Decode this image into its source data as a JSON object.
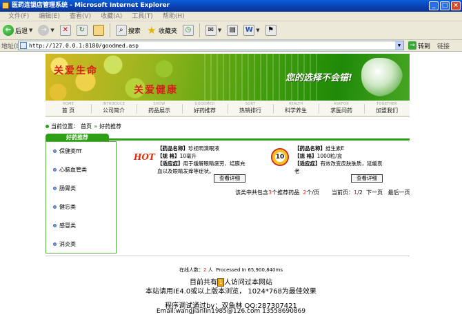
{
  "window": {
    "title": "医药连锁店管理系统 - Microsoft Internet Explorer",
    "controls": [
      "_",
      "□",
      "×"
    ]
  },
  "menu": [
    "文件(F)",
    "编辑(E)",
    "查看(V)",
    "收藏(A)",
    "工具(T)",
    "帮助(H)"
  ],
  "toolbar": {
    "back_label": "后退",
    "search_label": "搜索",
    "favorites_label": "收藏夹"
  },
  "address": {
    "label": "地址(D)",
    "url": "http://127.0.0.1:8180/goodmed.asp",
    "go_label": "转到",
    "links_label": "链接"
  },
  "banner": {
    "slogan_left_1": "关爱生命",
    "slogan_left_2": "关爱健康",
    "slogan_right": "您的选择不会错!"
  },
  "nav": [
    {
      "en": "HOME",
      "cn": "首 页"
    },
    {
      "en": "INTRODUCE",
      "cn": "公司简介"
    },
    {
      "en": "SHOW",
      "cn": "药品展示"
    },
    {
      "en": "GOODMED",
      "cn": "好药推荐"
    },
    {
      "en": "SORT",
      "cn": "热销排行"
    },
    {
      "en": "HEALTH",
      "cn": "科学养生"
    },
    {
      "en": "ASKFOR",
      "cn": "求医问药"
    },
    {
      "en": "TOGETHER",
      "cn": "加盟我们"
    }
  ],
  "breadcrumb": {
    "prefix": "当前位置：",
    "home": "首页",
    "arrow": "»",
    "current": "好药推荐"
  },
  "sidebar": {
    "tab_title": "好药推荐",
    "items": [
      "保健类fff",
      "心脑血管类",
      "肠胃类",
      "健忘类",
      "感冒类",
      "消炎类"
    ]
  },
  "products": [
    {
      "image_text": "HOT",
      "name_label": "【药品名称】",
      "name": "珍视明滴眼液",
      "spec_label": "【规  格】",
      "spec": "10毫升",
      "indication_label": "【适应症】",
      "indication": "用于缓解眼睛疲劳、结膜充血以及眼睛发痒等症状。",
      "detail_button": "查看详细"
    },
    {
      "image_text": "10",
      "name_label": "【药品名称】",
      "name": "维生素E",
      "spec_label": "【规  格】",
      "spec": "1000粒/盒",
      "indication_label": "【适应症】",
      "indication": "有效改变皮肤肤质，延缓衰老",
      "detail_button": "查看详细"
    }
  ],
  "pager": {
    "summary_pre": "该类中共包含",
    "total": "3",
    "summary_mid": "个推荐药品",
    "per_page": "2",
    "per_page_suffix": "个/页",
    "current_label": "当前页：",
    "current": "1",
    "slash": "/",
    "pages": "2",
    "next": "下一页",
    "last": "最后一页"
  },
  "footer": {
    "online_label": "在线人数：",
    "online_count": "2",
    "online_unit": "人",
    "processed": "Processed In 65,900,840ms",
    "visits_pre": "目前共有",
    "visits_count": "1",
    "visits_post": "人访问过本网站",
    "browser_note": "本站请用IE4.0或以上版本浏览， 1024*768为最佳效果",
    "debug_line": "程序调试通过by：双鱼林 QQ:287307421",
    "email_line": "Email:wangjianlin1985@126.com 13558690869"
  }
}
